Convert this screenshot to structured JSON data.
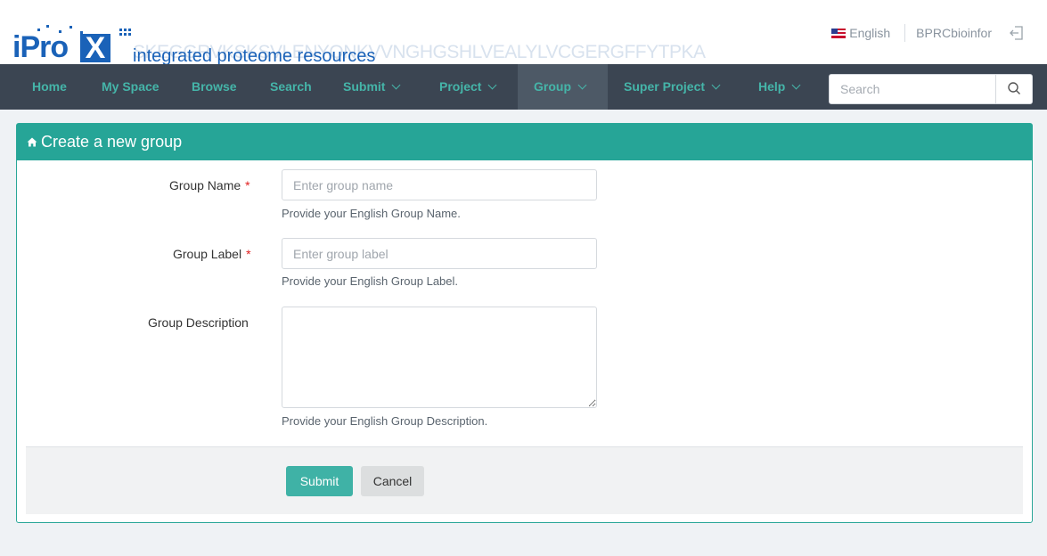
{
  "brand": {
    "logo_prefix": "iPro",
    "logo_x": "X",
    "tagline": "integrated proteome resources",
    "sequence_watermark": "SKEGGRVKSKSVLENYQNKVVNGHGSHLVEALYLVCGERGFFYTPKA"
  },
  "topbar": {
    "language": "English",
    "username": "BPRCbioinfor"
  },
  "nav": {
    "items": [
      {
        "label": "Home",
        "dropdown": false
      },
      {
        "label": "My Space",
        "dropdown": false
      },
      {
        "label": "Browse",
        "dropdown": false
      },
      {
        "label": "Search",
        "dropdown": false
      },
      {
        "label": "Submit",
        "dropdown": true
      },
      {
        "label": "Project",
        "dropdown": true
      },
      {
        "label": "Group",
        "dropdown": true,
        "active": true
      },
      {
        "label": "Super Project",
        "dropdown": true
      },
      {
        "label": "Help",
        "dropdown": true
      }
    ],
    "search_placeholder": "Search"
  },
  "panel": {
    "title": "Create a new group"
  },
  "form": {
    "group_name": {
      "label": "Group Name",
      "required_mark": "*",
      "placeholder": "Enter group name",
      "value": "",
      "help": "Provide your English Group Name."
    },
    "group_label": {
      "label": "Group Label",
      "required_mark": "*",
      "placeholder": "Enter group label",
      "value": "",
      "help": "Provide your English Group Label."
    },
    "group_description": {
      "label": "Group Description",
      "value": "",
      "help": "Provide your English Group Description."
    },
    "submit_label": "Submit",
    "cancel_label": "Cancel"
  },
  "colors": {
    "brand_blue": "#1a62b8",
    "nav_bg": "#3b4552",
    "accent_teal": "#26a597",
    "required_red": "#e02020"
  },
  "icons": {
    "home": "home-icon",
    "search": "search-icon",
    "logout": "logout-icon",
    "flag": "us-flag-icon",
    "caret": "chevron-down-icon"
  }
}
